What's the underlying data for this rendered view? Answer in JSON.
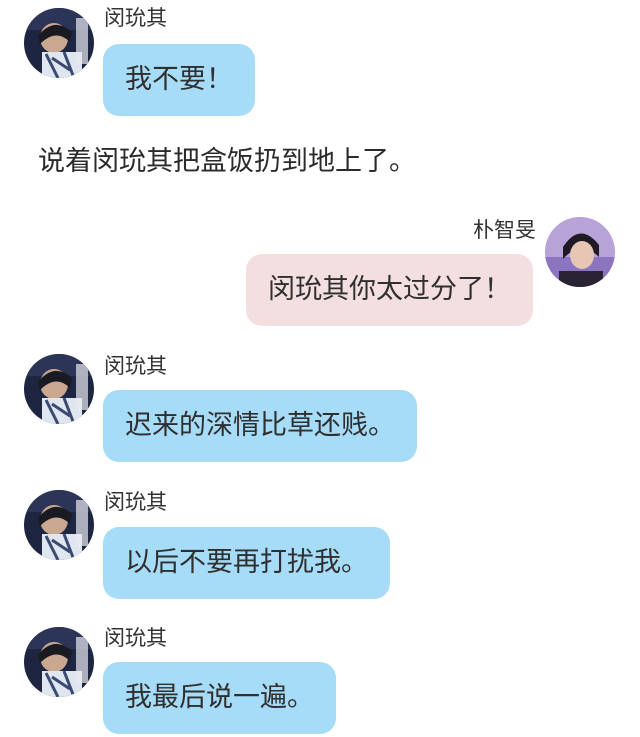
{
  "messages": [
    {
      "sender": "闵玧其",
      "text": "我不要！"
    },
    {
      "sender": "朴智旻",
      "text": "闵玧其你太过分了！"
    },
    {
      "sender": "闵玧其",
      "text": "迟来的深情比草还贱。"
    },
    {
      "sender": "闵玧其",
      "text": "以后不要再打扰我。"
    },
    {
      "sender": "闵玧其",
      "text": "我最后说一遍。"
    }
  ],
  "narration": "说着闵玧其把盒饭扔到地上了。",
  "colors": {
    "left_bubble": "#a6dcf7",
    "right_bubble": "#f3dfe0",
    "background": "#ffffff"
  }
}
